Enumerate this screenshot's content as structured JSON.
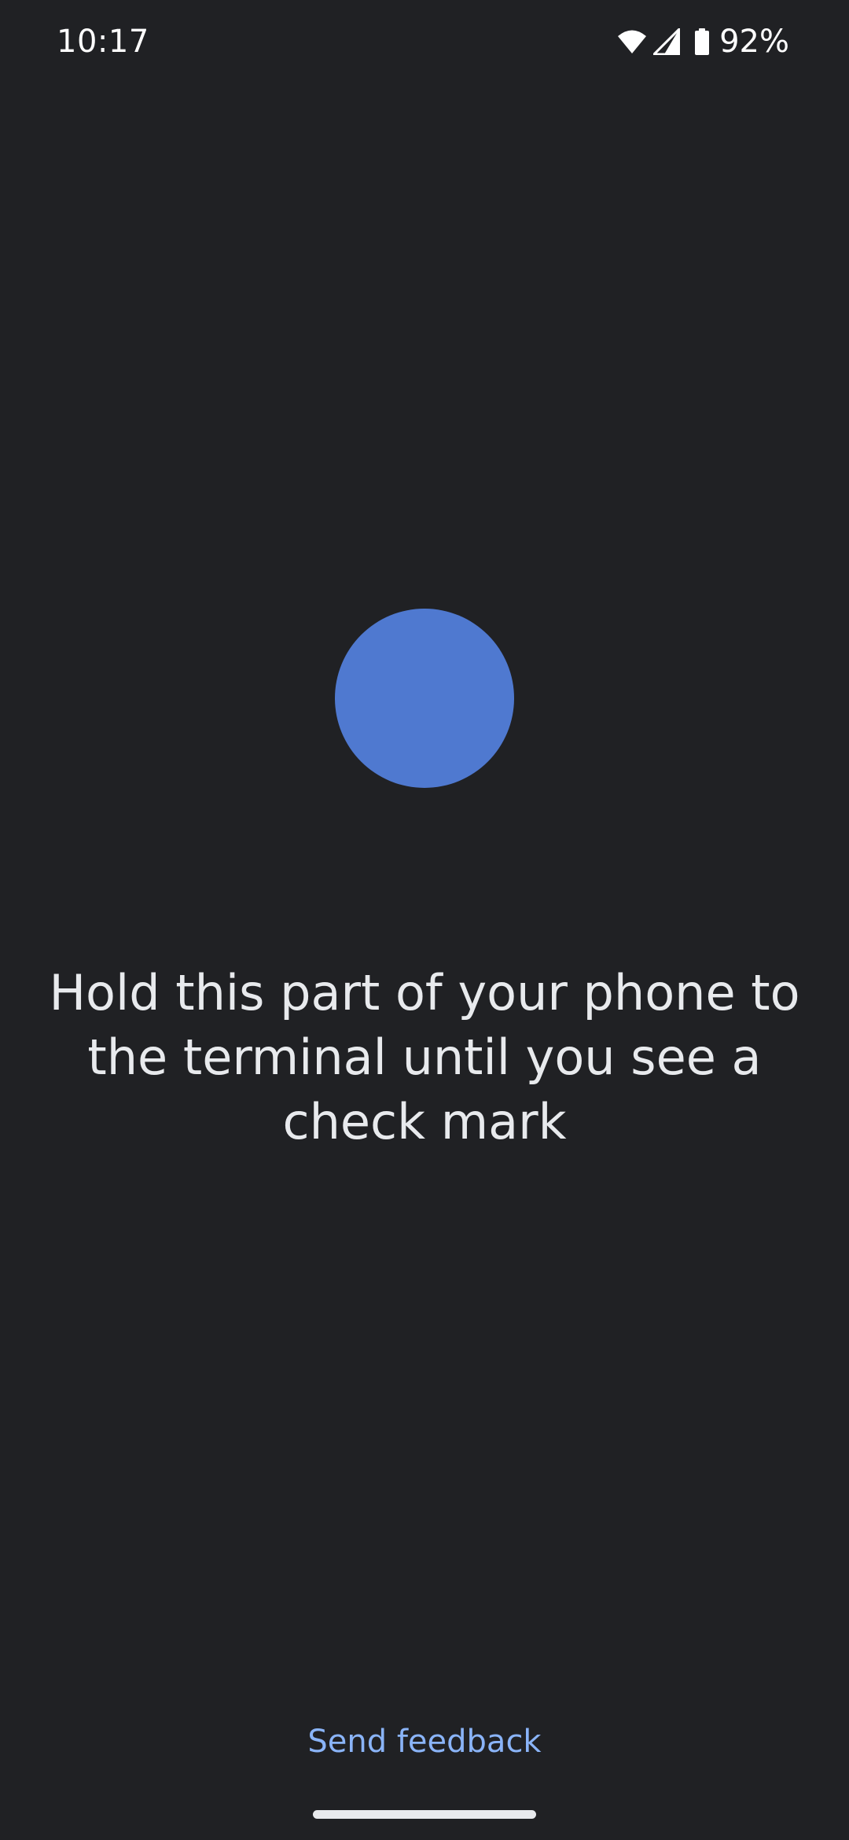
{
  "status_bar": {
    "time": "10:17",
    "battery_percent": "92%",
    "icons": [
      "wifi-icon",
      "cell-signal-icon",
      "battery-icon"
    ]
  },
  "instruction": {
    "text": "Hold this part of your phone to the terminal until you see a check mark"
  },
  "footer": {
    "send_feedback": "Send feedback"
  },
  "colors": {
    "background": "#202124",
    "target_circle": "#4f79d0",
    "link": "#8ab4f8",
    "text": "#e8eaed"
  }
}
